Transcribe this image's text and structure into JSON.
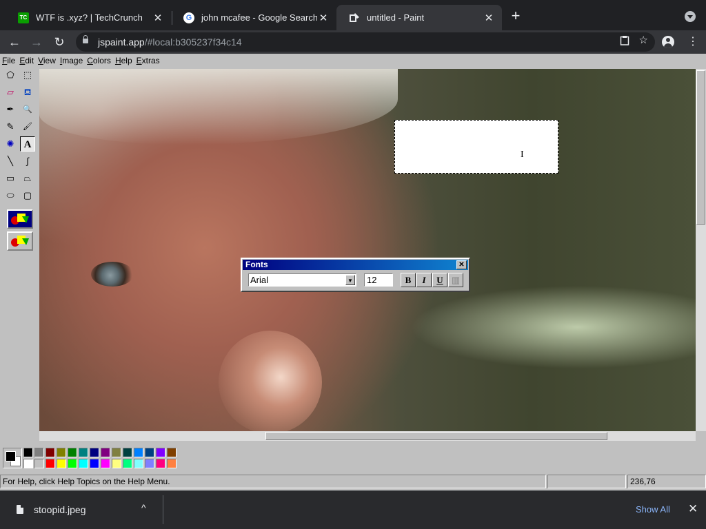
{
  "browser": {
    "tabs": [
      {
        "title": "WTF is .xyz? | TechCrunch",
        "favicon": "techcrunch-icon",
        "favicon_text": "TC",
        "active": false
      },
      {
        "title": "john mcafee - Google Search",
        "favicon": "google-icon",
        "favicon_text": "G",
        "active": false
      },
      {
        "title": "untitled - Paint",
        "favicon": "paint-icon",
        "favicon_text": "",
        "active": true
      }
    ],
    "close_glyph": "✕",
    "new_tab_glyph": "+",
    "url_host": "jspaint.app",
    "url_path": "/#local:b305237f34c14",
    "back_glyph": "←",
    "forward_glyph": "→",
    "reload_glyph": "↻",
    "star_glyph": "☆",
    "kebab_glyph": "⋮"
  },
  "paint": {
    "menu": [
      "File",
      "Edit",
      "View",
      "Image",
      "Colors",
      "Help",
      "Extras"
    ],
    "tools": [
      {
        "name": "free-form-select-tool",
        "glyph": "⬠"
      },
      {
        "name": "rect-select-tool",
        "glyph": "⬚"
      },
      {
        "name": "eraser-tool",
        "glyph": "▱"
      },
      {
        "name": "fill-tool",
        "glyph": "⛾"
      },
      {
        "name": "pick-color-tool",
        "glyph": "✒"
      },
      {
        "name": "magnifier-tool",
        "glyph": "🔍"
      },
      {
        "name": "pencil-tool",
        "glyph": "✎"
      },
      {
        "name": "brush-tool",
        "glyph": "🖌"
      },
      {
        "name": "airbrush-tool",
        "glyph": "✺"
      },
      {
        "name": "text-tool",
        "glyph": "A"
      },
      {
        "name": "line-tool",
        "glyph": "╲"
      },
      {
        "name": "curve-tool",
        "glyph": "∫"
      },
      {
        "name": "rectangle-tool",
        "glyph": "▭"
      },
      {
        "name": "polygon-tool",
        "glyph": "⏢"
      },
      {
        "name": "ellipse-tool",
        "glyph": "⬭"
      },
      {
        "name": "rounded-rect-tool",
        "glyph": "▢"
      }
    ],
    "selected_tool": "text-tool",
    "fonts_window": {
      "title": "Fonts",
      "font_name": "Arial",
      "font_size": "12",
      "bold": "B",
      "italic": "I",
      "underline": "U",
      "vertical": "▥",
      "close_glyph": "✕",
      "dropdown_glyph": "▼"
    },
    "text_cursor_glyph": "I",
    "palette": {
      "foreground": "#000000",
      "background": "#ffffff",
      "top_row": [
        "#000000",
        "#808080",
        "#800000",
        "#808000",
        "#008000",
        "#008080",
        "#000080",
        "#800080",
        "#808040",
        "#004040",
        "#0080ff",
        "#004080",
        "#8000ff",
        "#804000"
      ],
      "bottom_row": [
        "#ffffff",
        "#c0c0c0",
        "#ff0000",
        "#ffff00",
        "#00ff00",
        "#00ffff",
        "#0000ff",
        "#ff00ff",
        "#ffff80",
        "#00ff80",
        "#80ffff",
        "#8080ff",
        "#ff0080",
        "#ff8040"
      ]
    },
    "status": {
      "help_text": "For Help, click Help Topics on the Help Menu.",
      "size": "",
      "position": "236,76"
    }
  },
  "downloads": {
    "file": "stoopid.jpeg",
    "chevron": "^",
    "show_all": "Show All",
    "close_glyph": "✕"
  }
}
